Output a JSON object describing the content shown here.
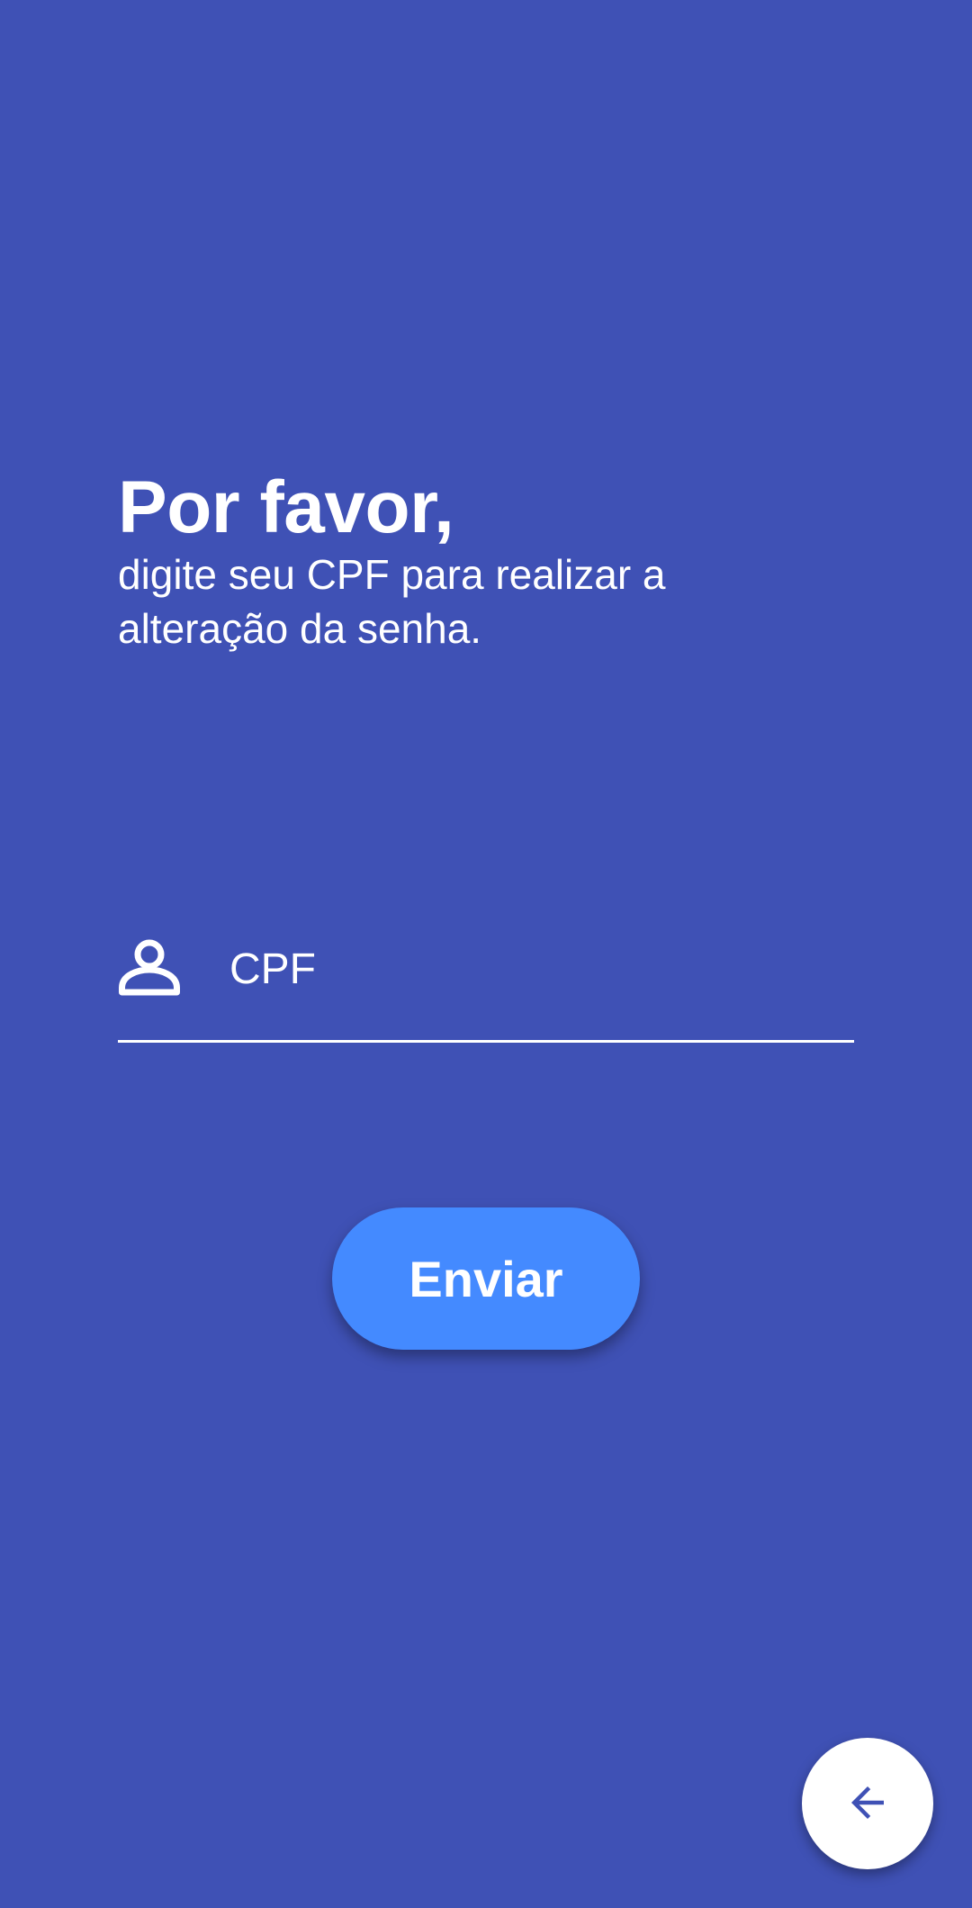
{
  "colors": {
    "background": "#3F51B5",
    "primary_button": "#448AFF",
    "text": "#FFFFFF",
    "fab_background": "#FFFFFF",
    "fab_icon": "#3F51B5"
  },
  "header": {
    "title": "Por favor,",
    "subtitle": "digite seu CPF para realizar a alteração da senha."
  },
  "form": {
    "cpf": {
      "icon": "person-icon",
      "placeholder": "CPF",
      "value": ""
    },
    "submit_label": "Enviar"
  },
  "fab": {
    "icon": "arrow-back-icon"
  }
}
